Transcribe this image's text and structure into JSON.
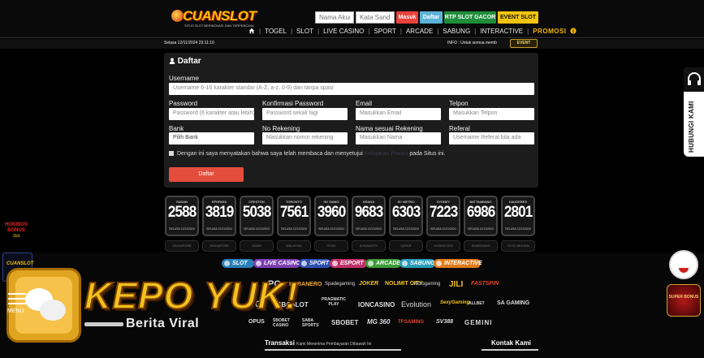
{
  "header": {
    "brand_main": "CUANSLOT",
    "brand_tagline": "SITUS SLOT BERINOVASI DAN TERPERCAYA",
    "username_placeholder": "Nama Akun",
    "password_placeholder": "Kata Sandi",
    "login_label": "Masuk",
    "register_label": "Daftar",
    "rtp_label": "RTP SLOT GACOR",
    "event_label": "EVENT SLOT",
    "colors": {
      "login": "#e8423c",
      "register": "#5bb3d8",
      "rtp": "#1f8d3a",
      "event": "#f1c40f"
    }
  },
  "nav": {
    "home_icon": "home-icon",
    "items": [
      "TOGEL",
      "SLOT",
      "LIVE CASINO",
      "SPORT",
      "ARCADE",
      "SABUNG",
      "INTERACTIVE"
    ],
    "promo": "PROMOSI",
    "promo_icon": "info-icon"
  },
  "ticker": {
    "datetime": "Selasa 12/11/2024 23:11:10",
    "info": "INFO : Untuk semua memb",
    "event_button": "EVENT"
  },
  "form": {
    "title": "Daftar",
    "title_icon": "user-icon",
    "username_label": "Username",
    "username_placeholder": "Username 6-16 karakter standar (A-Z, a-z, 0-9) dan tanpa spasi",
    "password_label": "Password",
    "password_placeholder": "Password (6 karakter atau lebih)",
    "confirm_label": "Konfirmasi Password",
    "confirm_placeholder": "Password sekali lagi",
    "email_label": "Email",
    "email_placeholder": "Masukkan Email",
    "phone_label": "Telpon",
    "phone_placeholder": "Masukkan Telpon",
    "bank_label": "Bank",
    "bank_value": "Pilih Bank",
    "account_label": "No Rekening",
    "account_placeholder": "Masukkan nomor rekening",
    "holder_label": "Nama sesuai Rekening",
    "holder_placeholder": "Masukkan Nama",
    "referral_label": "Referal",
    "referral_placeholder": "Username Referal bila ada",
    "agree_prefix": "Dengan ini saya menyatakan bahwa saya telah membaca dan menyetujui",
    "agree_link": "Kebijakan Privasi",
    "agree_suffix": "pada Situs ini.",
    "submit": "Daftar"
  },
  "results": [
    {
      "name": "SUDAN",
      "number": "2588",
      "date": "SELASA 12/11/2024"
    },
    {
      "name": "EPHRATA",
      "number": "3819",
      "date": "SELASA 12/11/2024"
    },
    {
      "name": "CRESTON",
      "number": "5038",
      "date": "SELASA 12/11/2024"
    },
    {
      "name": "TORONTO",
      "number": "7561",
      "date": "SELASA 12/11/2024"
    },
    {
      "name": "HK SIANG",
      "number": "3960",
      "date": "SELASA 12/11/2024"
    },
    {
      "name": "KRANJI",
      "number": "9683",
      "date": "SELASA 12/11/2024"
    },
    {
      "name": "SC METRO",
      "number": "6303",
      "date": "SELASA 12/11/2024"
    },
    {
      "name": "SYDNEY",
      "number": "7223",
      "date": "SELASA 12/11/2024"
    },
    {
      "name": "BATTAMBANG",
      "number": "6986",
      "date": "SELASA 12/11/2024"
    },
    {
      "name": "KAUDERES",
      "number": "2801",
      "date": "SELASA 12/11/2024"
    }
  ],
  "results_row2": [
    "SINGAPORE",
    "SINGAPORE",
    "OMAN",
    "MALAYSIA",
    "PCSO",
    "KUNANGTO",
    "QATAR",
    "HONGKONG",
    "SUMEDANG",
    "TOTO WUHAN"
  ],
  "categories": [
    {
      "label": "SLOT",
      "color": "#2b7fb7"
    },
    {
      "label": "LIVE CASINO",
      "color": "#7b3fb0"
    },
    {
      "label": "SPORT",
      "color": "#2d4fb2"
    },
    {
      "label": "ESPORT",
      "color": "#c0306a"
    },
    {
      "label": "ARCADE",
      "color": "#3f9b3a"
    },
    {
      "label": "SABUNG",
      "color": "#2a9bb8"
    },
    {
      "label": "INTERACTIVE",
      "color": "#e07b1c"
    }
  ],
  "providers_row1": [
    "PG",
    "HABANERO",
    "Spadegaming",
    "JOKER",
    "NOLIMIT CITY",
    "Microgaming",
    "JILI",
    "FASTSPIN"
  ],
  "providers_row2": [
    "CQ9",
    "SBOSLOT",
    "PRAGMATIC PLAY",
    "IONCASINO",
    "Evolution",
    "SexyGaming",
    "ALLBET",
    "SA GAMING"
  ],
  "providers_row3": [
    "OPUS",
    "SBOBET CASINO",
    "SABA SPORTS",
    "SBOBET",
    "MG 360",
    "TFGAMING",
    "SV388",
    "GEMINI"
  ],
  "footer": {
    "transaksi": "Transaksi",
    "transaksi_sub": "Kami Menerima Pembayaran Dibawah Ini",
    "kontak": "Kontak Kami"
  },
  "side": {
    "help_label": "HUBUNGI KAMI",
    "help_icon": "headset-icon"
  },
  "overlay": {
    "menu_label": "MENU",
    "menu_icon": "chat-icon",
    "headline": "KEPO YUK!",
    "subline": "Berita Viral"
  },
  "promo_left": {
    "title": "HOKIBOS BONUS",
    "sub": "Slot"
  },
  "promo_right": {
    "label": "SUPER BONUS"
  }
}
